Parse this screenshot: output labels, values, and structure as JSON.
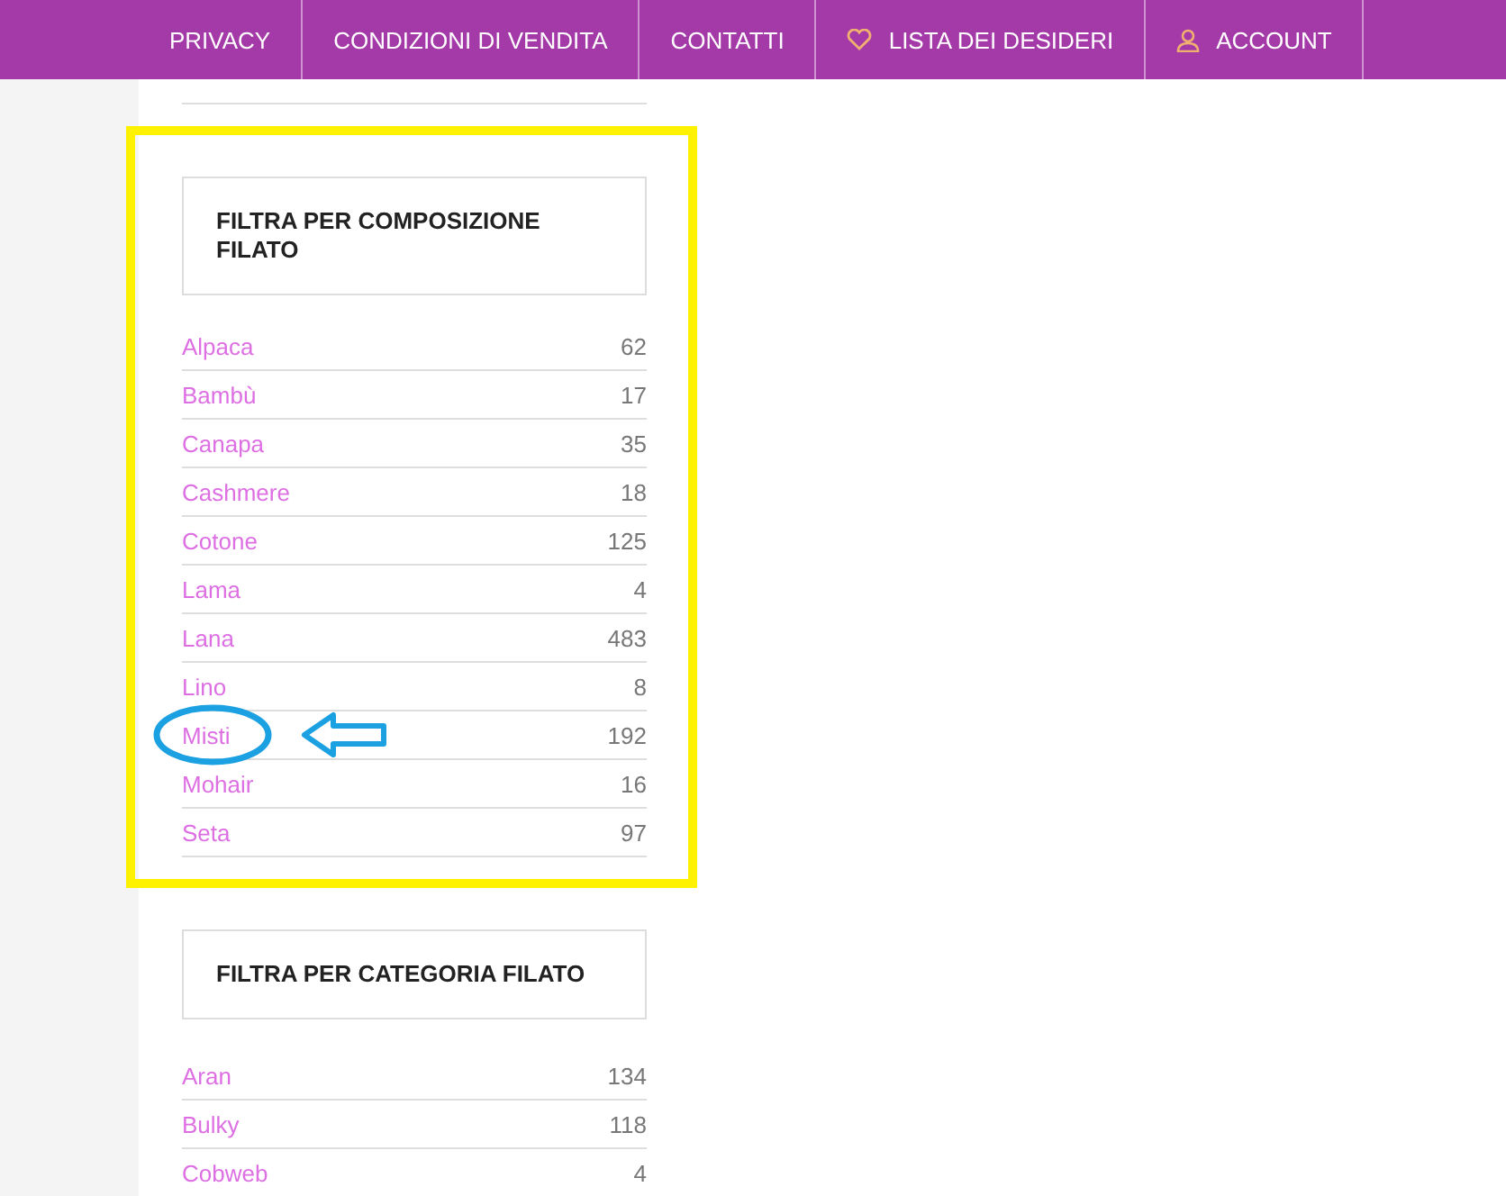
{
  "nav": {
    "items": [
      {
        "label": "PRIVACY"
      },
      {
        "label": "CONDIZIONI DI VENDITA"
      },
      {
        "label": "CONTATTI"
      },
      {
        "label": "LISTA DEI DESIDERI"
      },
      {
        "label": "ACCOUNT"
      }
    ]
  },
  "widgets": [
    {
      "title": "FILTRA PER COMPOSIZIONE FILATO",
      "highlighted": true,
      "rows": [
        {
          "name": "Alpaca",
          "count": "62",
          "annotated": false
        },
        {
          "name": "Bambù",
          "count": "17",
          "annotated": false
        },
        {
          "name": "Canapa",
          "count": "35",
          "annotated": false
        },
        {
          "name": "Cashmere",
          "count": "18",
          "annotated": false
        },
        {
          "name": "Cotone",
          "count": "125",
          "annotated": false
        },
        {
          "name": "Lama",
          "count": "4",
          "annotated": false
        },
        {
          "name": "Lana",
          "count": "483",
          "annotated": false
        },
        {
          "name": "Lino",
          "count": "8",
          "annotated": false
        },
        {
          "name": "Misti",
          "count": "192",
          "annotated": true
        },
        {
          "name": "Mohair",
          "count": "16",
          "annotated": false
        },
        {
          "name": "Seta",
          "count": "97",
          "annotated": false
        }
      ]
    },
    {
      "title": "FILTRA PER CATEGORIA FILATO",
      "highlighted": false,
      "rows": [
        {
          "name": "Aran",
          "count": "134",
          "annotated": false
        },
        {
          "name": "Bulky",
          "count": "118",
          "annotated": false
        },
        {
          "name": "Cobweb",
          "count": "4",
          "annotated": false
        }
      ]
    }
  ]
}
